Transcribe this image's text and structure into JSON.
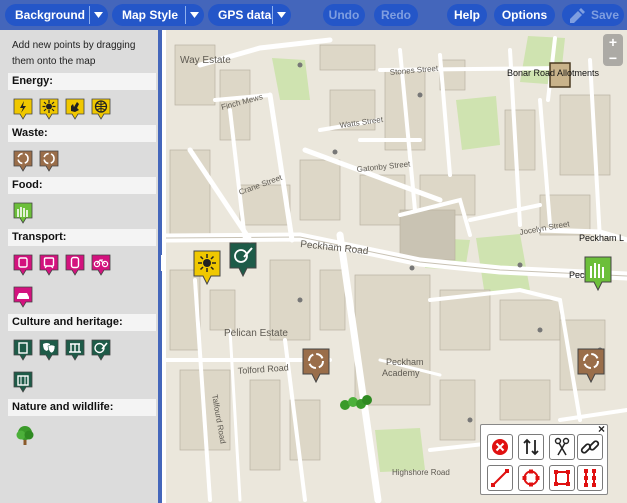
{
  "toolbar": {
    "background_label": "Background",
    "map_style_label": "Map Style",
    "gps_label": "GPS data",
    "undo_label": "Undo",
    "redo_label": "Redo",
    "help_label": "Help",
    "options_label": "Options",
    "save_label": "Save"
  },
  "sidebar": {
    "intro": "Add new points by dragging them onto the map",
    "categories": {
      "energy": "Energy:",
      "waste": "Waste:",
      "food": "Food:",
      "transport": "Transport:",
      "culture": "Culture and heritage:",
      "nature": "Nature and wildlife:"
    }
  },
  "map": {
    "labels": {
      "allotments": "Bonar Road Allotments",
      "peckham_road": "Peckham Road",
      "peckham_right": "Peckham L",
      "pec": "Pec",
      "pelican_estate": "Pelican Estate",
      "peckham_academy_1": "Peckham",
      "peckham_academy_2": "Academy",
      "tolford_road": "Tolford Road",
      "way_estate": "Way Estate",
      "finch_mews": "Finch Mews",
      "crane_street": "Crane Street",
      "watts_street": "Watts Street",
      "gatonby_street": "Gatonby Street",
      "stones_street": "Stones Street",
      "highshore_road": "Highshore Road",
      "talfourd_road": "Talfourd Road",
      "jocelyn_street": "Jocelyn Street"
    }
  },
  "colors": {
    "accent": "#4466bb",
    "button": "#2456c8",
    "energy": "#f0c800",
    "waste": "#9a6e4a",
    "food": "#6cbf3a",
    "transport": "#d3127e",
    "culture": "#1e5b48",
    "park": "#cfe3b0",
    "building": "#ddd7c7"
  },
  "editor": {
    "tools": [
      "delete-icon",
      "reverse-icon",
      "split-icon",
      "join-icon",
      "line-icon",
      "circle-icon",
      "square-icon",
      "parallel-icon"
    ]
  }
}
